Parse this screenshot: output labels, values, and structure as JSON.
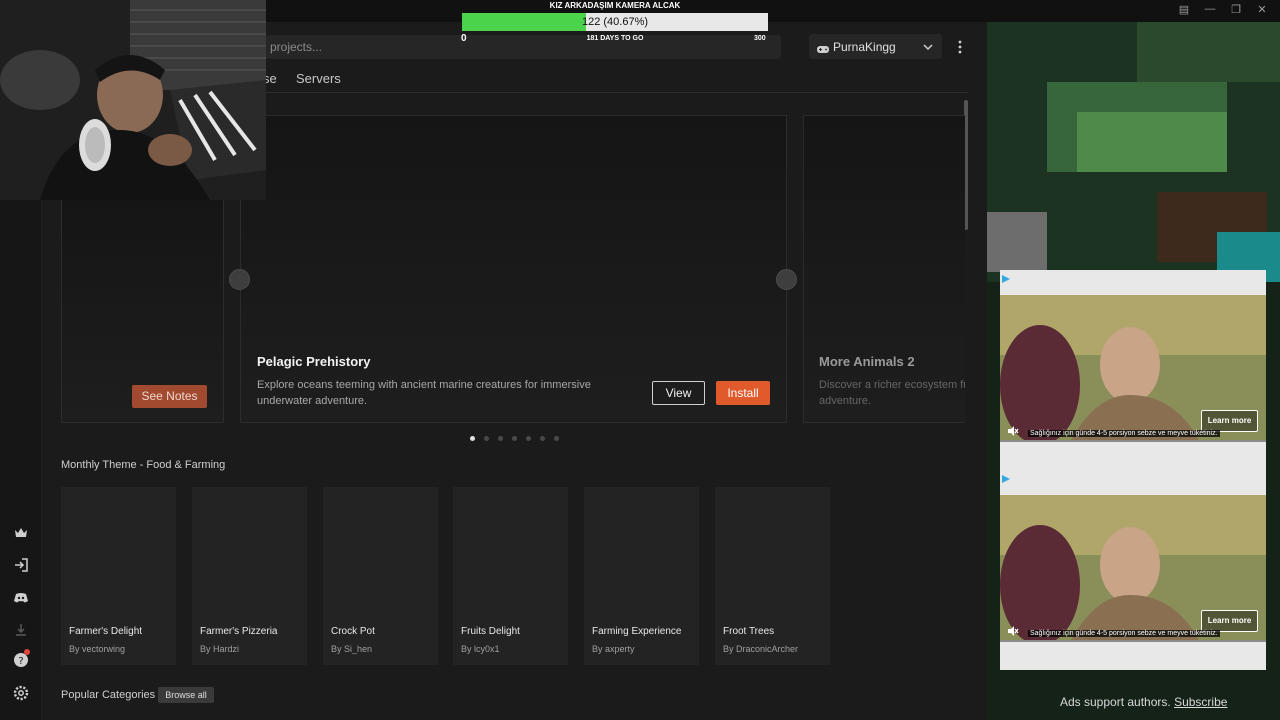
{
  "app": {
    "search_placeholder": "projects...",
    "tabs": [
      "se",
      "Servers"
    ],
    "user": {
      "name": "PurnaKingg"
    }
  },
  "featured": {
    "left_button": "See Notes",
    "main": {
      "title": "Pelagic Prehistory",
      "description": "Explore oceans teeming with ancient marine creatures for immersive underwater adventure.",
      "view_label": "View",
      "install_label": "Install"
    },
    "next": {
      "title": "More Animals 2",
      "description": "Discover a richer ecosystem ful",
      "description2": "adventure."
    },
    "dots_count": 7,
    "active_dot": 0
  },
  "monthly_theme": {
    "title": "Monthly Theme - Food & Farming",
    "items": [
      {
        "name": "Farmer's Delight",
        "author": "By vectorwing"
      },
      {
        "name": "Farmer's Pizzeria",
        "author": "By Hardzi"
      },
      {
        "name": "Crock Pot",
        "author": "By Si_hen"
      },
      {
        "name": "Fruits Delight",
        "author": "By lcy0x1"
      },
      {
        "name": "Farming Experience",
        "author": "By axperty"
      },
      {
        "name": "Froot Trees",
        "author": "By DraconicArcher"
      }
    ]
  },
  "popular": {
    "title": "Popular Categories",
    "browse_all": "Browse all"
  },
  "goal": {
    "title": "KIZ ARKADAŞIM KAMERA ALCAK",
    "progress_text": "122 (40.67%)",
    "progress_fraction": 0.4067,
    "min": "0",
    "days": "181 DAYS TO GO",
    "max": "300"
  },
  "ads": {
    "learn_more": "Learn more",
    "caption": "Sağlığınız için günde 4-5 porsiyon sebze ve meyve tüketiniz.",
    "support_text": "Ads support authors.",
    "subscribe": "Subscribe"
  },
  "colors": {
    "accent": "#e05a2c",
    "goal_fill": "#4cd34c",
    "panel": "#1b1b1b"
  }
}
